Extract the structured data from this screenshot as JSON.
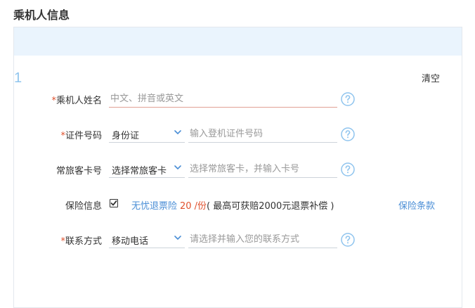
{
  "page": {
    "title": "乘机人信息"
  },
  "passenger": {
    "index": "1",
    "clear_label": "清空",
    "name": {
      "label": "乘机人姓名",
      "required_mark": "*",
      "placeholder": "中文、拼音或英文"
    },
    "id_doc": {
      "label": "证件号码",
      "required_mark": "*",
      "type_value": "身份证",
      "placeholder": "输入登机证件号码"
    },
    "ffp": {
      "label": "常旅客卡号",
      "type_value": "选择常旅客卡",
      "placeholder": "选择常旅客卡，并输入卡号"
    },
    "insurance": {
      "label": "保险信息",
      "checked": true,
      "name": "无忧退票险",
      "price": "20 /份",
      "note": "( 最高可获赔2000元退票补偿 )",
      "terms_label": "保险条款"
    },
    "contact": {
      "label": "联系方式",
      "required_mark": "*",
      "type_value": "移动电话",
      "placeholder": "请选择并输入您的联系方式"
    }
  },
  "colors": {
    "accent": "#4a8ed6",
    "required": "#e0502c",
    "help_icon": "#8fc4ee",
    "banner": "#eaf4fd"
  },
  "icons": {
    "help": "question-circle-icon",
    "dropdown": "chevron-down-icon",
    "checkbox": "check-icon"
  }
}
